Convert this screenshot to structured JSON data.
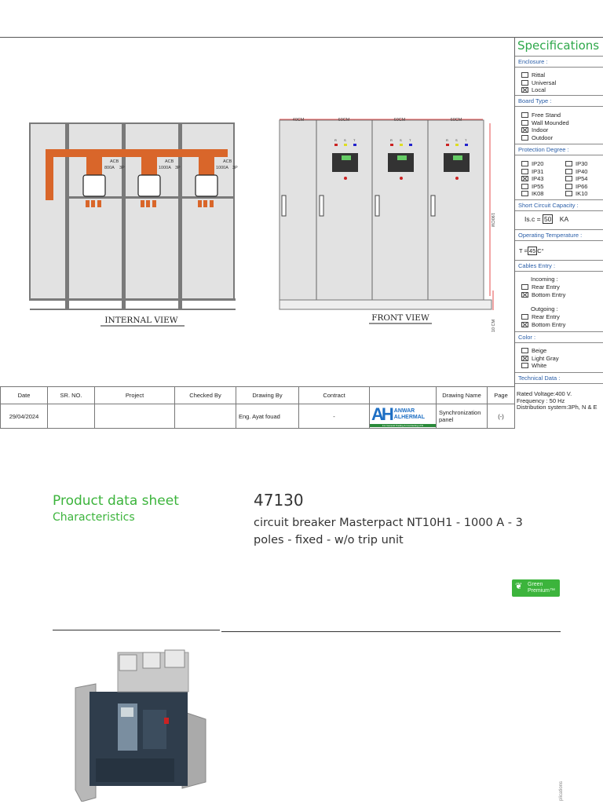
{
  "drawing": {
    "internal_view": {
      "title": "INTERNAL VIEW",
      "breakers": [
        {
          "label": "ACB",
          "rating": "800A",
          "poles": "3P"
        },
        {
          "label": "ACB",
          "rating": "1000A",
          "poles": "3P"
        },
        {
          "label": "ACB",
          "rating": "1000A",
          "poles": "3P"
        }
      ]
    },
    "front_view": {
      "title": "FRONT VIEW",
      "widths": [
        "40CM",
        "60CM",
        "60CM",
        "60CM"
      ],
      "height": "190CM",
      "base": "10 CM",
      "phases": [
        "R",
        "S",
        "T"
      ]
    },
    "colors": {
      "busbar": "#d9662a",
      "panel": "#e2e2e2",
      "frame": "#7a7a7a",
      "dim": "#e02020"
    }
  },
  "specifications": {
    "title": "Specifications",
    "enclosure": {
      "label": "Enclosure :",
      "options": [
        {
          "name": "Rittal",
          "checked": false
        },
        {
          "name": "Universal",
          "checked": false
        },
        {
          "name": "Local",
          "checked": true
        }
      ]
    },
    "board_type": {
      "label": "Board Type :",
      "options": [
        {
          "name": "Free Stand",
          "checked": false
        },
        {
          "name": "Wall Mounded",
          "checked": false
        },
        {
          "name": "Indoor",
          "checked": true
        },
        {
          "name": "Outdoor",
          "checked": false
        }
      ]
    },
    "protection": {
      "label": "Protection Degree :",
      "left": [
        {
          "name": "IP20",
          "checked": false
        },
        {
          "name": "IP31",
          "checked": false
        },
        {
          "name": "IP43",
          "checked": true
        },
        {
          "name": "IP55",
          "checked": false
        },
        {
          "name": "IK08",
          "checked": false
        }
      ],
      "right": [
        {
          "name": "IP30",
          "checked": false
        },
        {
          "name": "IP40",
          "checked": false
        },
        {
          "name": "IP54",
          "checked": false
        },
        {
          "name": "IP66",
          "checked": false
        },
        {
          "name": "IK10",
          "checked": false
        }
      ]
    },
    "short_circuit": {
      "label": "Short Circuit Capacity :",
      "prefix": "Is.c =",
      "value": "50",
      "unit": "KA"
    },
    "temperature": {
      "label": "Operating Temperature :",
      "prefix": "T =",
      "value": "45",
      "unit": "C°"
    },
    "cables": {
      "label": "Cables Entry :",
      "incoming": "Incoming :",
      "outgoing": "Outgoing :",
      "in_options": [
        {
          "name": "Rear Entry",
          "checked": false
        },
        {
          "name": "Bottom Entry",
          "checked": true
        }
      ],
      "out_options": [
        {
          "name": "Rear Entry",
          "checked": false
        },
        {
          "name": "Bottom Entry",
          "checked": true
        }
      ]
    },
    "color": {
      "label": "Color :",
      "options": [
        {
          "name": "Beige",
          "checked": false
        },
        {
          "name": "Light Gray",
          "checked": true
        },
        {
          "name": "White",
          "checked": false
        }
      ]
    },
    "technical": {
      "label": "Technical Data :",
      "lines": [
        "Rated Voltage:400 V.",
        "Frequency : 50 Hz",
        "Distribution system:3Ph, N & E"
      ]
    }
  },
  "title_block": {
    "headers": [
      "Date",
      "SR. NO.",
      "Project",
      "Checked By",
      "Drawing By",
      "Contract",
      "",
      "Drawing Name",
      "Page"
    ],
    "values": [
      "29/04/2024",
      "",
      "",
      "",
      "Eng. Ayat fouad",
      "-",
      "",
      "Synchronization panel",
      "(-)"
    ],
    "logo": {
      "letters": "AH",
      "line1": "ANWAR",
      "line2": "ALHERMAL",
      "tagline": "For General Trading & Contracting LTD"
    }
  },
  "datasheet": {
    "title": "Product data sheet",
    "subtitle": "Characteristics",
    "ref": "47130",
    "desc_line1": "circuit breaker Masterpact NT10H1 - 1000 A - 3",
    "desc_line2": "poles - fixed - w/o trip unit",
    "badge": {
      "line1": "Green",
      "line2": "Premium™"
    },
    "side_text": "plications",
    "accent": "#3cb43c"
  }
}
